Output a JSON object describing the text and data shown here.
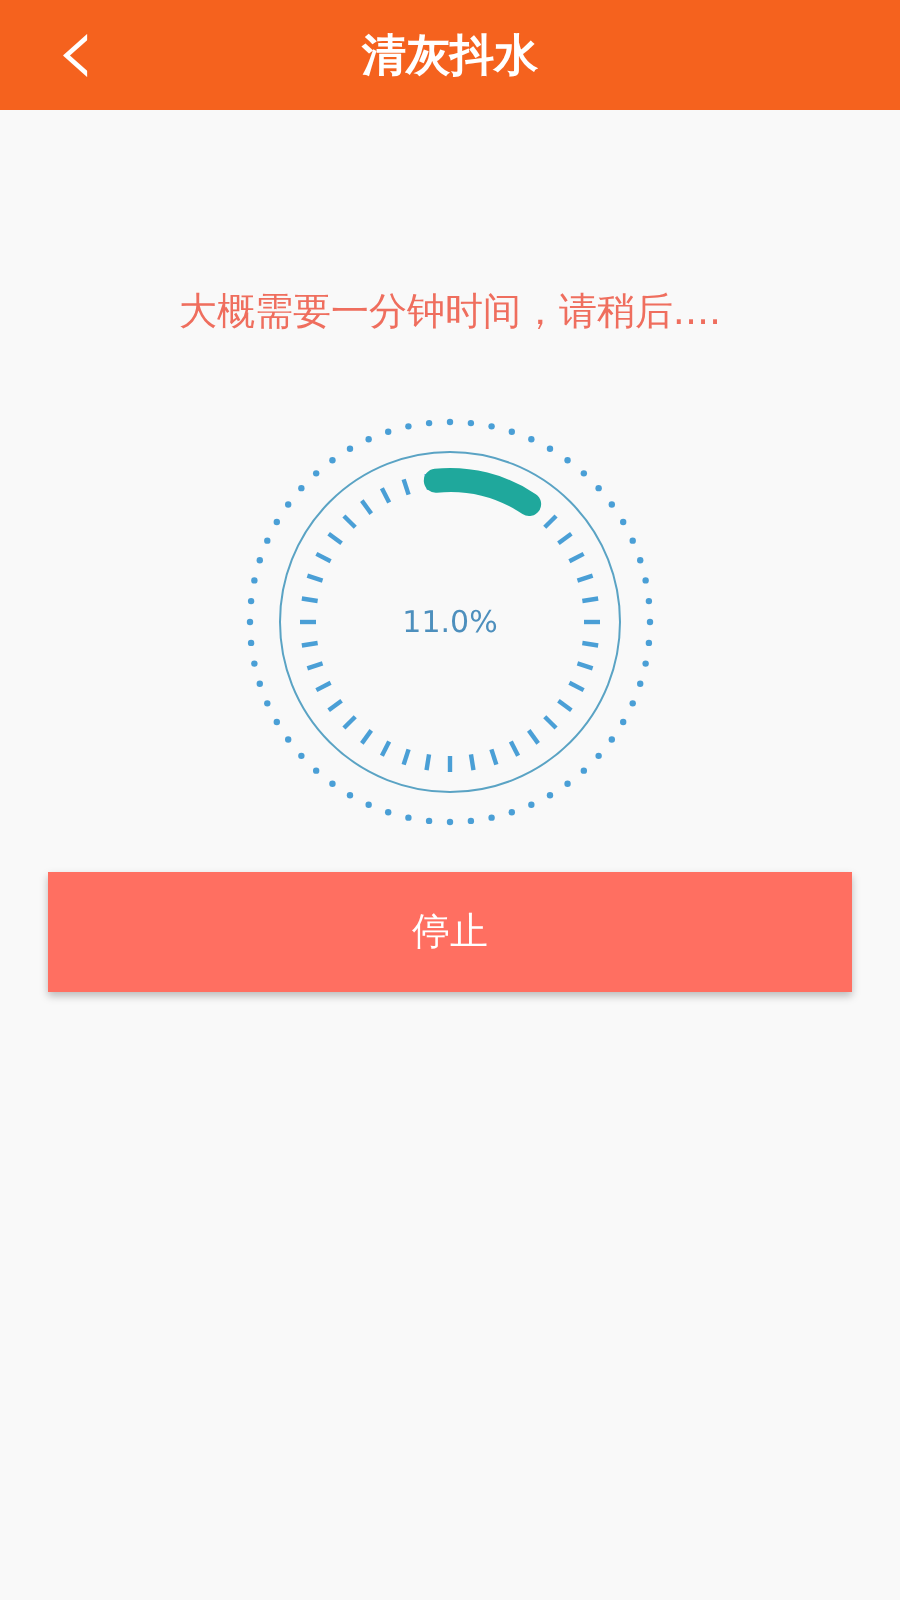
{
  "header": {
    "back_icon": "‹",
    "title": "清灰抖水"
  },
  "message": "大概需要一分钟时间，请稍后....",
  "progress": {
    "reading": "11.0%"
  },
  "button": "停止"
}
